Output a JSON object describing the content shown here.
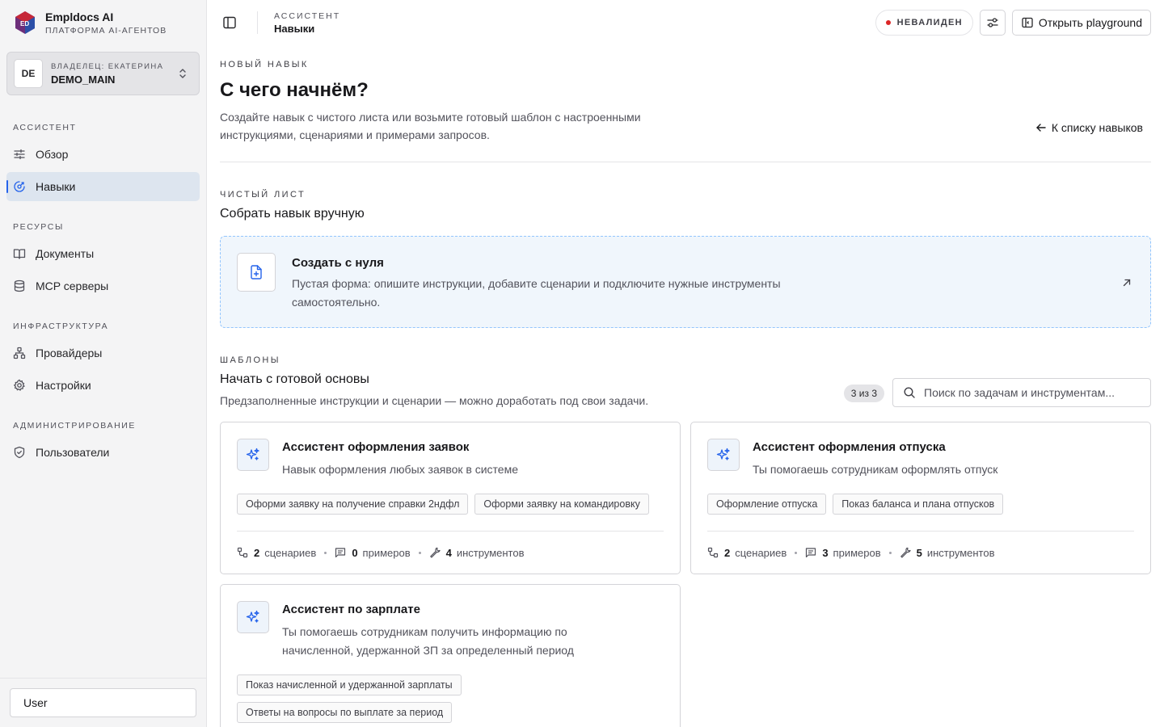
{
  "brand": {
    "name": "Empldocs AI",
    "subtitle": "ПЛАТФОРМА AI-АГЕНТОВ",
    "logo_text": "ED"
  },
  "owner": {
    "avatar": "DE",
    "label": "ВЛАДЕЛЕЦ: ЕКАТЕРИНА",
    "name": "DEMO_MAIN"
  },
  "sidebar": {
    "sections": [
      {
        "title": "АССИСТЕНТ",
        "items": [
          {
            "label": "Обзор",
            "icon": "sliders-icon"
          },
          {
            "label": "Навыки",
            "icon": "skills-icon",
            "active": true
          }
        ]
      },
      {
        "title": "РЕСУРСЫ",
        "items": [
          {
            "label": "Документы",
            "icon": "book-icon"
          },
          {
            "label": "MCP серверы",
            "icon": "database-icon"
          }
        ]
      },
      {
        "title": "ИНФРАСТРУКТУРА",
        "items": [
          {
            "label": "Провайдеры",
            "icon": "network-icon"
          },
          {
            "label": "Настройки",
            "icon": "gear-icon"
          }
        ]
      },
      {
        "title": "АДМИНИСТРИРОВАНИЕ",
        "items": [
          {
            "label": "Пользователи",
            "icon": "shield-icon"
          }
        ]
      }
    ],
    "user": "User"
  },
  "topbar": {
    "crumb_top": "АССИСТЕНТ",
    "crumb_main": "Навыки",
    "status": "НЕВАЛИДЕН",
    "status_color": "#dc2626",
    "playground": "Открыть playground"
  },
  "header": {
    "eyebrow": "НОВЫЙ НАВЫК",
    "title": "С чего начнём?",
    "lead": "Создайте навык с чистого листа или возьмите готовый шаблон с настроенными инструкциями, сценариями и примерами запросов.",
    "back": "К списку навыков"
  },
  "blank": {
    "eyebrow": "ЧИСТЫЙ ЛИСТ",
    "title": "Собрать навык вручную",
    "card_title": "Создать с нуля",
    "card_desc": "Пустая форма: опишите инструкции, добавите сценарии и подключите нужные инструменты самостоятельно."
  },
  "templates": {
    "eyebrow": "ШАБЛОНЫ",
    "title": "Начать с готовой основы",
    "desc": "Предзаполненные инструкции и сценарии — можно доработать под свои задачи.",
    "count": "3 из 3",
    "search_placeholder": "Поиск по задачам и инструментам...",
    "labels": {
      "scenarios": "сценариев",
      "examples": "примеров",
      "tools": "инструментов"
    },
    "items": [
      {
        "title": "Ассистент оформления заявок",
        "desc": "Навык оформления любых заявок в системе",
        "chips": [
          "Оформи заявку на получение справки 2ндфл",
          "Оформи заявку на командировку"
        ],
        "scenarios": "2",
        "examples": "0",
        "tools": "4"
      },
      {
        "title": "Ассистент оформления отпуска",
        "desc": "Ты помогаешь сотрудникам оформлять отпуск",
        "chips": [
          "Оформление отпуска",
          "Показ баланса и плана отпусков"
        ],
        "scenarios": "2",
        "examples": "3",
        "tools": "5"
      },
      {
        "title": "Ассистент по зарплате",
        "desc": "Ты помогаешь сотрудникам получить информацию по начисленной, удержанной ЗП за определенный период",
        "chips": [
          "Показ начисленной и удержанной зарплаты",
          "Ответы на вопросы по выплате за период"
        ]
      }
    ]
  }
}
